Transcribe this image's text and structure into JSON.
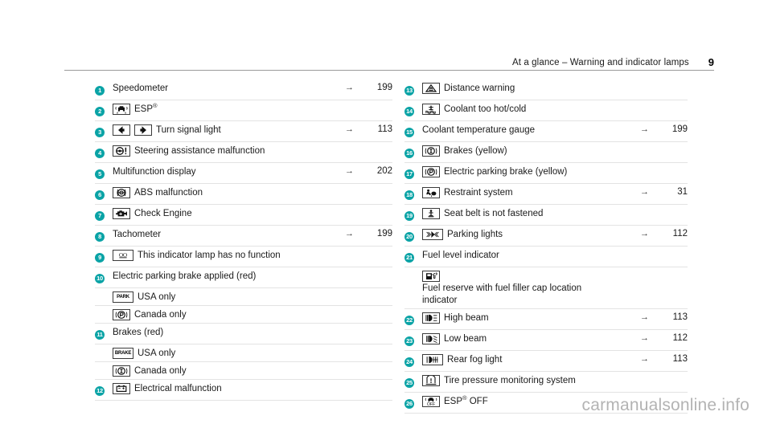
{
  "header": {
    "title": "At a glance – Warning and indicator lamps",
    "page_number": "9"
  },
  "watermark": "carmanualsonline.info",
  "ref_arrow": "→",
  "left_column": [
    {
      "num": "1",
      "icons": [],
      "label": "Speedometer",
      "ref": "199"
    },
    {
      "num": "2",
      "icons": [
        "esp-icon"
      ],
      "label": "ESP®",
      "ref": ""
    },
    {
      "num": "3",
      "icons": [
        "turn-left-icon",
        "turn-right-icon"
      ],
      "label": "Turn signal light",
      "ref": "113"
    },
    {
      "num": "4",
      "icons": [
        "steering-assist-icon"
      ],
      "label": "Steering assistance malfunction",
      "ref": ""
    },
    {
      "num": "5",
      "icons": [],
      "label": "Multifunction display",
      "ref": "202"
    },
    {
      "num": "6",
      "icons": [
        "abs-icon"
      ],
      "label": "ABS malfunction",
      "ref": ""
    },
    {
      "num": "7",
      "icons": [
        "check-engine-icon"
      ],
      "label": "Check Engine",
      "ref": ""
    },
    {
      "num": "8",
      "icons": [],
      "label": "Tachometer",
      "ref": "199"
    },
    {
      "num": "9",
      "icons": [
        "no-function-icon"
      ],
      "label": "This indicator lamp has no function",
      "ref": ""
    },
    {
      "num": "10",
      "icons": [],
      "label": "Electric parking brake applied (red)",
      "ref": ""
    },
    {
      "num": "",
      "icons": [
        "park-text-icon"
      ],
      "label": "USA only",
      "ref": ""
    },
    {
      "num": "",
      "icons": [
        "parking-brake-p-icon"
      ],
      "label": "Canada only",
      "ref": ""
    },
    {
      "num": "11",
      "icons": [],
      "label": "Brakes (red)",
      "ref": ""
    },
    {
      "num": "",
      "icons": [
        "brake-text-icon"
      ],
      "label": "USA only",
      "ref": ""
    },
    {
      "num": "",
      "icons": [
        "brake-circle-icon"
      ],
      "label": "Canada only",
      "ref": ""
    },
    {
      "num": "12",
      "icons": [
        "battery-icon"
      ],
      "label": "Electrical malfunction",
      "ref": ""
    }
  ],
  "right_column": [
    {
      "num": "13",
      "icons": [
        "distance-warning-icon"
      ],
      "label": "Distance warning",
      "ref": ""
    },
    {
      "num": "14",
      "icons": [
        "coolant-temp-icon"
      ],
      "label": "Coolant too hot/cold",
      "ref": ""
    },
    {
      "num": "15",
      "icons": [],
      "label": "Coolant temperature gauge",
      "ref": "199"
    },
    {
      "num": "16",
      "icons": [
        "brake-circle-icon"
      ],
      "label": "Brakes (yellow)",
      "ref": ""
    },
    {
      "num": "17",
      "icons": [
        "parking-brake-p-icon"
      ],
      "label": "Electric parking brake (yellow)",
      "ref": ""
    },
    {
      "num": "18",
      "icons": [
        "restraint-system-icon"
      ],
      "label": "Restraint system",
      "ref": "31"
    },
    {
      "num": "19",
      "icons": [
        "seat-belt-icon"
      ],
      "label": "Seat belt is not fastened",
      "ref": ""
    },
    {
      "num": "20",
      "icons": [
        "parking-lights-icon"
      ],
      "label": "Parking lights",
      "ref": "112"
    },
    {
      "num": "21",
      "icons": [],
      "label": "Fuel level indicator",
      "ref": ""
    },
    {
      "num": "",
      "icons": [
        "fuel-reserve-icon"
      ],
      "label": "Fuel reserve with fuel filler cap location indicator",
      "ref": ""
    },
    {
      "num": "22",
      "icons": [
        "high-beam-icon"
      ],
      "label": "High beam",
      "ref": "113"
    },
    {
      "num": "23",
      "icons": [
        "low-beam-icon"
      ],
      "label": "Low beam",
      "ref": "112"
    },
    {
      "num": "24",
      "icons": [
        "rear-fog-icon"
      ],
      "label": "Rear fog light",
      "ref": "113"
    },
    {
      "num": "25",
      "icons": [
        "tire-pressure-icon"
      ],
      "label": "Tire pressure monitoring system",
      "ref": ""
    },
    {
      "num": "26",
      "icons": [
        "esp-off-icon"
      ],
      "label": "ESP® OFF",
      "ref": ""
    }
  ],
  "colors": {
    "accent_teal": "#0aa3a6",
    "rule": "#e3e3e3",
    "header_rule": "#9a9a9a",
    "watermark": "#b3b3b3"
  }
}
